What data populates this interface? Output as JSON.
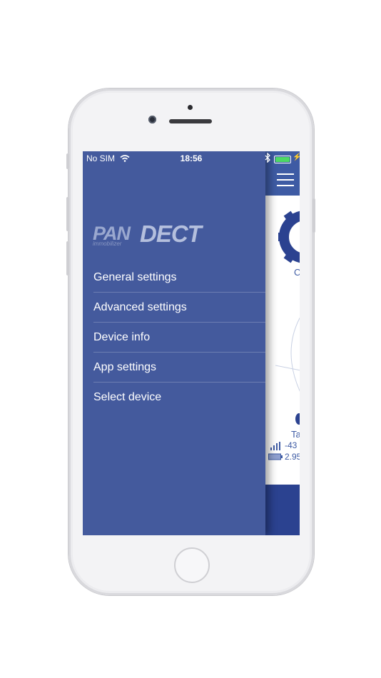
{
  "status_bar": {
    "carrier": "No SIM",
    "time": "18:56",
    "bluetooth": "bluetooth-icon",
    "battery_level": 1.0
  },
  "app": {
    "behind_texts": {
      "c": "C",
      "ta": "Ta",
      "signal": "-43",
      "battery": "2.95"
    },
    "colors": {
      "header": "#3e5ba4",
      "bottom": "#2b4290"
    }
  },
  "drawer": {
    "logo": {
      "main": "PANDECT",
      "sub": "immobilizer"
    },
    "menu": [
      {
        "label": "General settings"
      },
      {
        "label": "Advanced settings"
      },
      {
        "label": "Device info"
      },
      {
        "label": "App settings"
      },
      {
        "label": "Select device"
      }
    ],
    "colors": {
      "background": "#445a9d"
    }
  }
}
